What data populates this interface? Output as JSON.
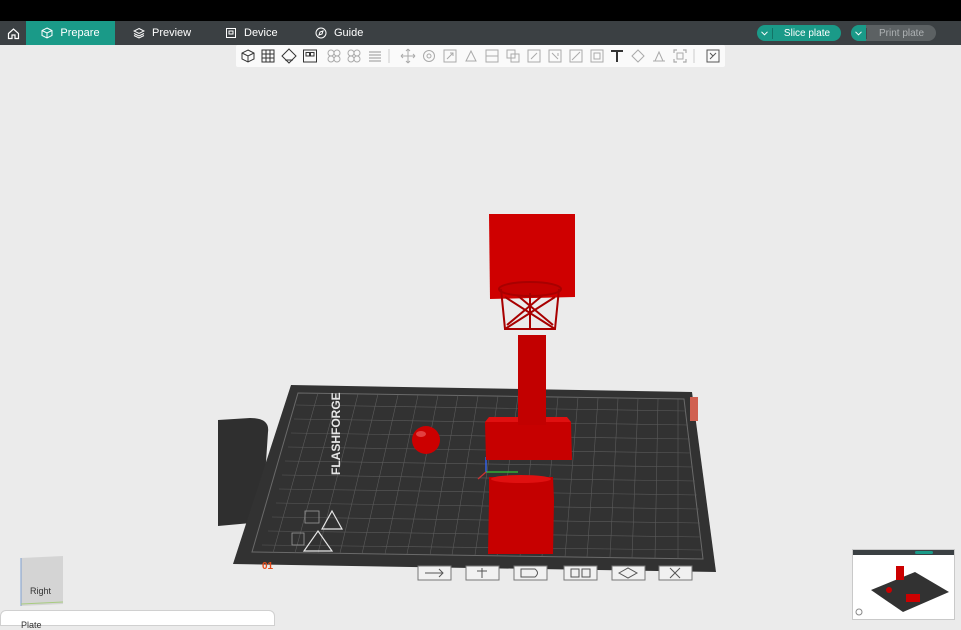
{
  "menu": {
    "tabs": [
      {
        "label": "Prepare",
        "icon": "cube-icon"
      },
      {
        "label": "Preview",
        "icon": "layers-icon"
      },
      {
        "label": "Device",
        "icon": "device-icon"
      },
      {
        "label": "Guide",
        "icon": "compass-icon"
      }
    ],
    "slice_label": "Slice plate",
    "print_label": "Print plate"
  },
  "bed": {
    "brand": "FLASHFORGE"
  },
  "viewcube": {
    "face_label": "Right"
  },
  "object_list": {
    "label": "Plate"
  },
  "colors": {
    "accent": "#1a9a88",
    "menubar": "#3b4043",
    "model": "#cc0000",
    "bed": "#333333"
  }
}
